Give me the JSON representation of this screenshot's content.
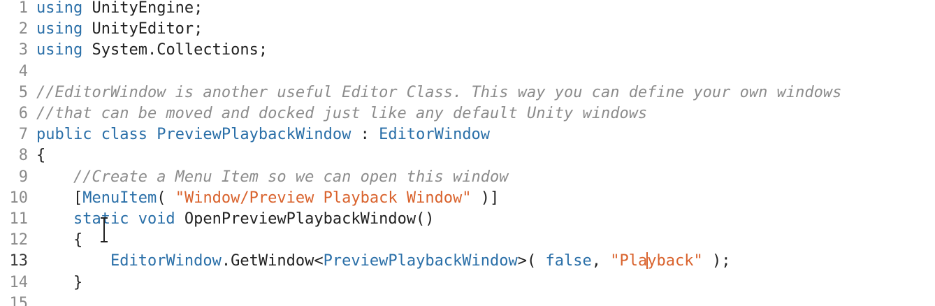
{
  "lines": [
    {
      "n": "1",
      "tokens": [
        {
          "t": "using",
          "c": "kw"
        },
        {
          "t": " UnityEngine;",
          "c": "plain"
        }
      ]
    },
    {
      "n": "2",
      "tokens": [
        {
          "t": "using",
          "c": "kw"
        },
        {
          "t": " UnityEditor;",
          "c": "plain"
        }
      ]
    },
    {
      "n": "3",
      "tokens": [
        {
          "t": "using",
          "c": "kw"
        },
        {
          "t": " System.Collections;",
          "c": "plain"
        }
      ]
    },
    {
      "n": "4",
      "tokens": []
    },
    {
      "n": "5",
      "tokens": [
        {
          "t": "//EditorWindow is another useful Editor Class. This way you can define your own windows",
          "c": "cm"
        }
      ]
    },
    {
      "n": "6",
      "tokens": [
        {
          "t": "//that can be moved and docked just like any default Unity windows",
          "c": "cm"
        }
      ]
    },
    {
      "n": "7",
      "tokens": [
        {
          "t": "public class",
          "c": "kw"
        },
        {
          "t": " ",
          "c": "plain"
        },
        {
          "t": "PreviewPlaybackWindow",
          "c": "type"
        },
        {
          "t": " : ",
          "c": "plain"
        },
        {
          "t": "EditorWindow",
          "c": "type"
        }
      ]
    },
    {
      "n": "8",
      "tokens": [
        {
          "t": "{",
          "c": "plain"
        }
      ]
    },
    {
      "n": "9",
      "tokens": [
        {
          "t": "    ",
          "c": "plain"
        },
        {
          "t": "//Create a Menu Item so we can open this window",
          "c": "cm"
        }
      ]
    },
    {
      "n": "10",
      "tokens": [
        {
          "t": "    [",
          "c": "plain"
        },
        {
          "t": "MenuItem",
          "c": "attr"
        },
        {
          "t": "( ",
          "c": "plain"
        },
        {
          "t": "\"Window/Preview Playback Window\"",
          "c": "str"
        },
        {
          "t": " )]",
          "c": "plain"
        }
      ]
    },
    {
      "n": "11",
      "tokens": [
        {
          "t": "    ",
          "c": "plain"
        },
        {
          "t": "static void",
          "c": "kw"
        },
        {
          "t": " OpenPreviewPlaybackWindow()",
          "c": "plain"
        }
      ]
    },
    {
      "n": "12",
      "tokens": [
        {
          "t": "    {",
          "c": "plain"
        }
      ]
    },
    {
      "n": "13",
      "active": true,
      "tokens": [
        {
          "t": "        ",
          "c": "plain"
        },
        {
          "t": "EditorWindow",
          "c": "type"
        },
        {
          "t": ".GetWindow<",
          "c": "plain"
        },
        {
          "t": "PreviewPlaybackWindow",
          "c": "type"
        },
        {
          "t": ">( ",
          "c": "plain"
        },
        {
          "t": "false",
          "c": "kw"
        },
        {
          "t": ", ",
          "c": "plain"
        },
        {
          "t": "\"Pla",
          "c": "str"
        },
        {
          "t": "|",
          "c": "caret"
        },
        {
          "t": "yback\"",
          "c": "str"
        },
        {
          "t": " );",
          "c": "plain"
        }
      ]
    },
    {
      "n": "14",
      "tokens": [
        {
          "t": "    }",
          "c": "plain"
        }
      ]
    },
    {
      "n": "15",
      "tokens": []
    }
  ]
}
